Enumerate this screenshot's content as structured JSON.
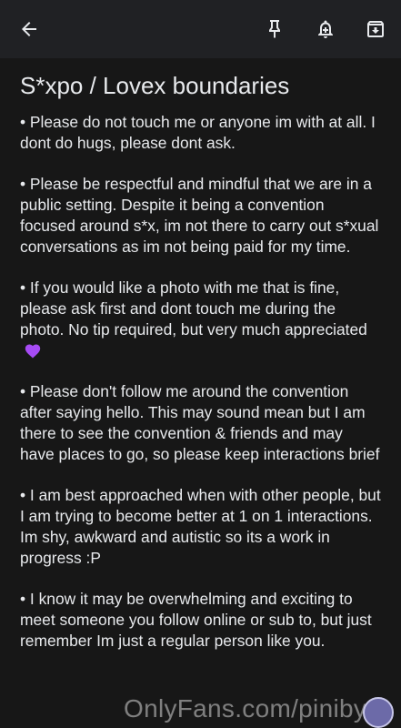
{
  "toolbar": {
    "back_icon": "arrow-left-icon",
    "pin_icon": "pin-icon",
    "reminder_icon": "bell-add-icon",
    "archive_icon": "archive-icon"
  },
  "note": {
    "title": "S*xpo / Lovex boundaries",
    "paragraphs": [
      "• Please do not touch me or anyone im with at all. I dont do hugs, please dont ask.",
      "• Please be respectful and mindful that we are in a public setting. Despite it being a convention focused around s*x, im not there to carry out s*xual conversations as im not being paid for my time.",
      "• If you would like a photo with me that is fine, please ask first and dont touch me during the photo. No tip required, but very much appreciated",
      "• Please don't follow me around the convention after saying hello. This may sound mean but I am there to see the convention & friends and may have places to go, so please keep interactions brief",
      "• I am best approached when with other people, but I am trying to become better at 1 on 1 interactions. Im shy, awkward and autistic so its a work in progress :P",
      "• I know it may be overwhelming and exciting to meet someone you follow online or sub to, but just remember Im just a regular person like you."
    ],
    "emoji_name": "purple-heart-icon"
  },
  "watermark": "OnlyFans.com/piniby",
  "colors": {
    "background": "#202124",
    "note_background": "#171717",
    "text": "#e8eaed",
    "heart": "#a64bf4"
  }
}
